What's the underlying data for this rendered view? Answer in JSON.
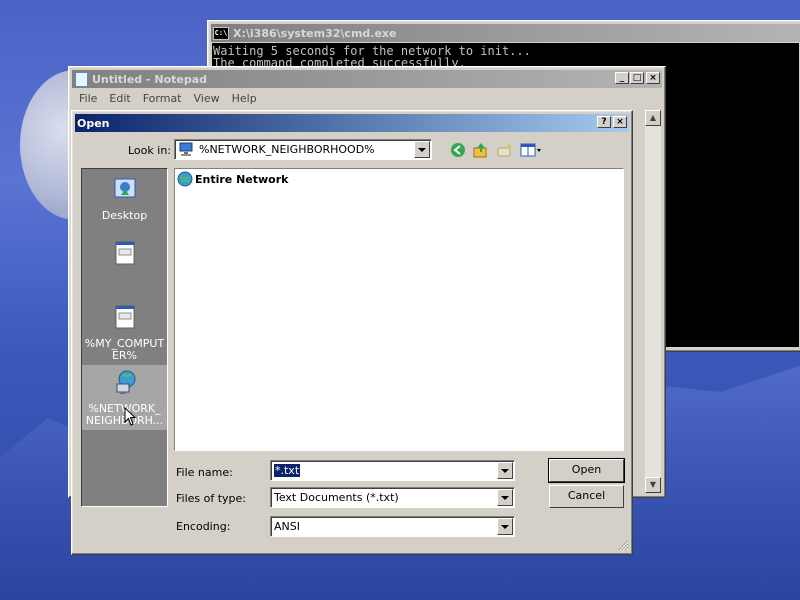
{
  "cmd": {
    "title": "X:\\i386\\system32\\cmd.exe",
    "icon_text": "C:\\",
    "lines": [
      "Waiting 5 seconds for the network to init...",
      "The command completed successfully."
    ]
  },
  "notepad": {
    "title": "Untitled - Notepad",
    "menu": [
      "File",
      "Edit",
      "Format",
      "View",
      "Help"
    ]
  },
  "dialog": {
    "title": "Open",
    "look_in_label": "Look in:",
    "look_in_value": "%NETWORK_NEIGHBORHOOD%",
    "places": [
      {
        "label": "Desktop",
        "icon": "desktop-icon"
      },
      {
        "label": "",
        "icon": "window-icon"
      },
      {
        "label": "%MY_COMPUTER%",
        "line1": "%MY_COMPUT",
        "line2": "ER%",
        "icon": "window-icon"
      },
      {
        "label": "%NETWORK_NEIGHBORHOOD%",
        "line1": "%NETWORK_",
        "line2": "NEIGHBORH...",
        "icon": "network-icon"
      }
    ],
    "files": [
      {
        "name": "Entire Network",
        "icon": "globe-icon"
      }
    ],
    "file_name_label": "File name:",
    "file_name_value": "*.txt",
    "file_type_label": "Files of type:",
    "file_type_value": "Text Documents (*.txt)",
    "encoding_label": "Encoding:",
    "encoding_value": "ANSI",
    "open_label": "Open",
    "cancel_label": "Cancel",
    "help_glyph": "?",
    "close_glyph": "×"
  },
  "colors": {
    "title_active": "#0a246a",
    "title_inactive": "#808080",
    "face": "#d4d0c8"
  }
}
